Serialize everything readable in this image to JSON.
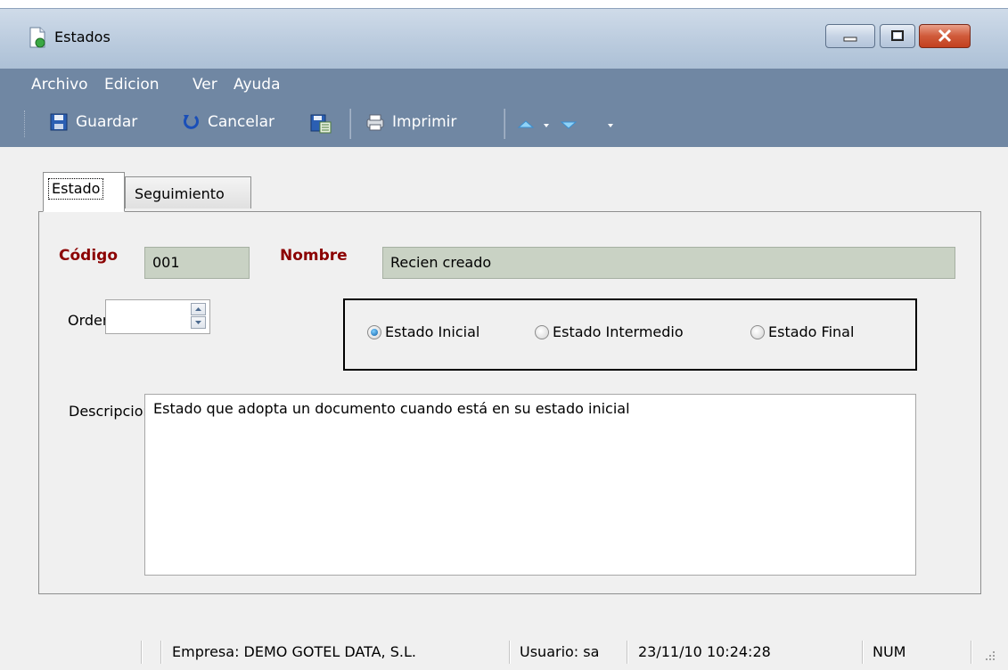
{
  "window": {
    "title": "Estados",
    "icon": "document-icon"
  },
  "menu": {
    "items": [
      "Archivo",
      "Edicion",
      "Ver",
      "Ayuda"
    ]
  },
  "toolbar": {
    "save_label": "Guardar",
    "cancel_label": "Cancelar",
    "print_label": "Imprimir"
  },
  "tabs": [
    {
      "label": "Estado",
      "active": true
    },
    {
      "label": "Seguimiento",
      "active": false
    }
  ],
  "form": {
    "codigo_label": "Código",
    "codigo_value": "001",
    "nombre_label": "Nombre",
    "nombre_value": "Recien creado",
    "orden_label": "Orden",
    "orden_value": "",
    "radios": [
      {
        "label": "Estado Inicial",
        "checked": true
      },
      {
        "label": "Estado Intermedio",
        "checked": false
      },
      {
        "label": "Estado Final",
        "checked": false
      }
    ],
    "descripcion_label": "Descripcion",
    "descripcion_value": "Estado que adopta un documento cuando está en su estado inicial"
  },
  "status": {
    "empresa": "Empresa: DEMO GOTEL DATA, S.L.",
    "usuario": "Usuario: sa",
    "datetime": "23/11/10 10:24:28",
    "num": "NUM"
  },
  "colors": {
    "menubar": "#7087a3",
    "required_label": "#8b0000",
    "readonly_field": "#c9d2c4"
  }
}
